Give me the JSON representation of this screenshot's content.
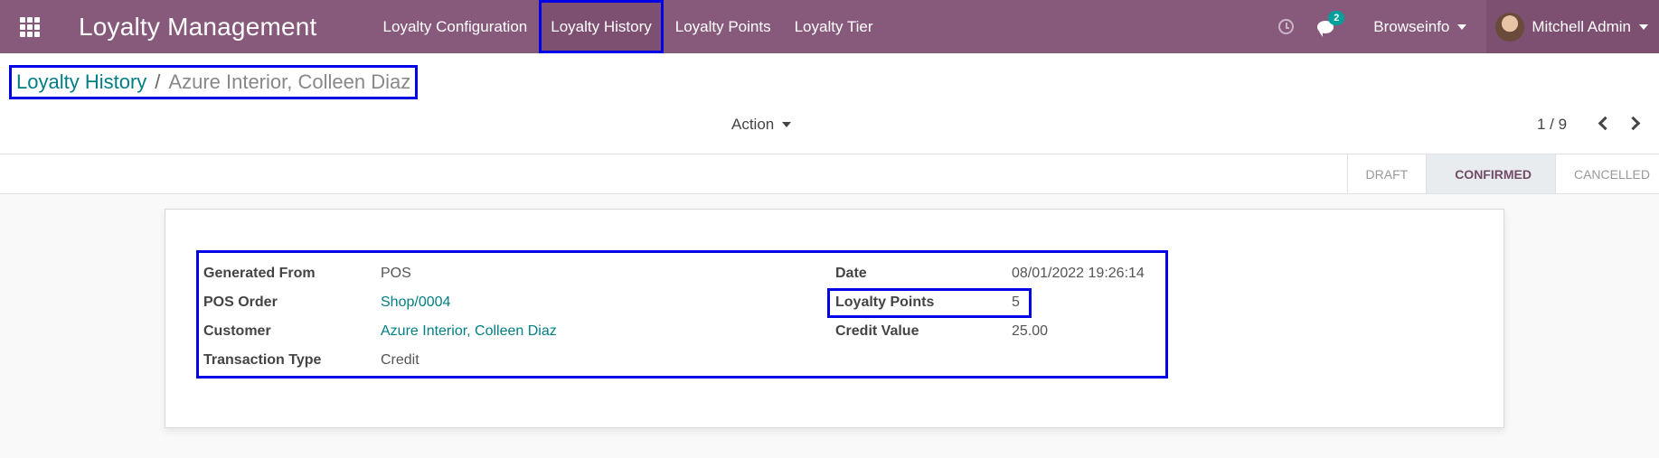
{
  "navbar": {
    "app_title": "Loyalty Management",
    "menu": [
      {
        "label": "Loyalty Configuration"
      },
      {
        "label": "Loyalty History"
      },
      {
        "label": "Loyalty Points"
      },
      {
        "label": "Loyalty Tier"
      }
    ],
    "chat_count": "2",
    "company": "Browseinfo",
    "user": "Mitchell Admin",
    "icons": [
      "apps-grid-icon",
      "clock-icon",
      "chat-icon",
      "caret-down-icon",
      "avatar"
    ]
  },
  "breadcrumb": {
    "parent": "Loyalty History",
    "separator": "/",
    "current": "Azure Interior, Colleen Diaz"
  },
  "toolbar": {
    "action_label": "Action",
    "pager": "1 / 9"
  },
  "status": {
    "stages": [
      "DRAFT",
      "CONFIRMED",
      "CANCELLED"
    ],
    "current": "CONFIRMED"
  },
  "form": {
    "generated_from_label": "Generated From",
    "generated_from": "POS",
    "pos_order_label": "POS Order",
    "pos_order": "Shop/0004",
    "customer_label": "Customer",
    "customer": "Azure Interior, Colleen Diaz",
    "transaction_type_label": "Transaction Type",
    "transaction_type": "Credit",
    "date_label": "Date",
    "date": "08/01/2022 19:26:14",
    "loyalty_points_label": "Loyalty Points",
    "loyalty_points": "5",
    "credit_value_label": "Credit Value",
    "credit_value": "25.00"
  },
  "colors": {
    "navbar": "#875a7b",
    "link": "#017e84",
    "highlight": "#0000e6",
    "badge": "#00a09d"
  }
}
